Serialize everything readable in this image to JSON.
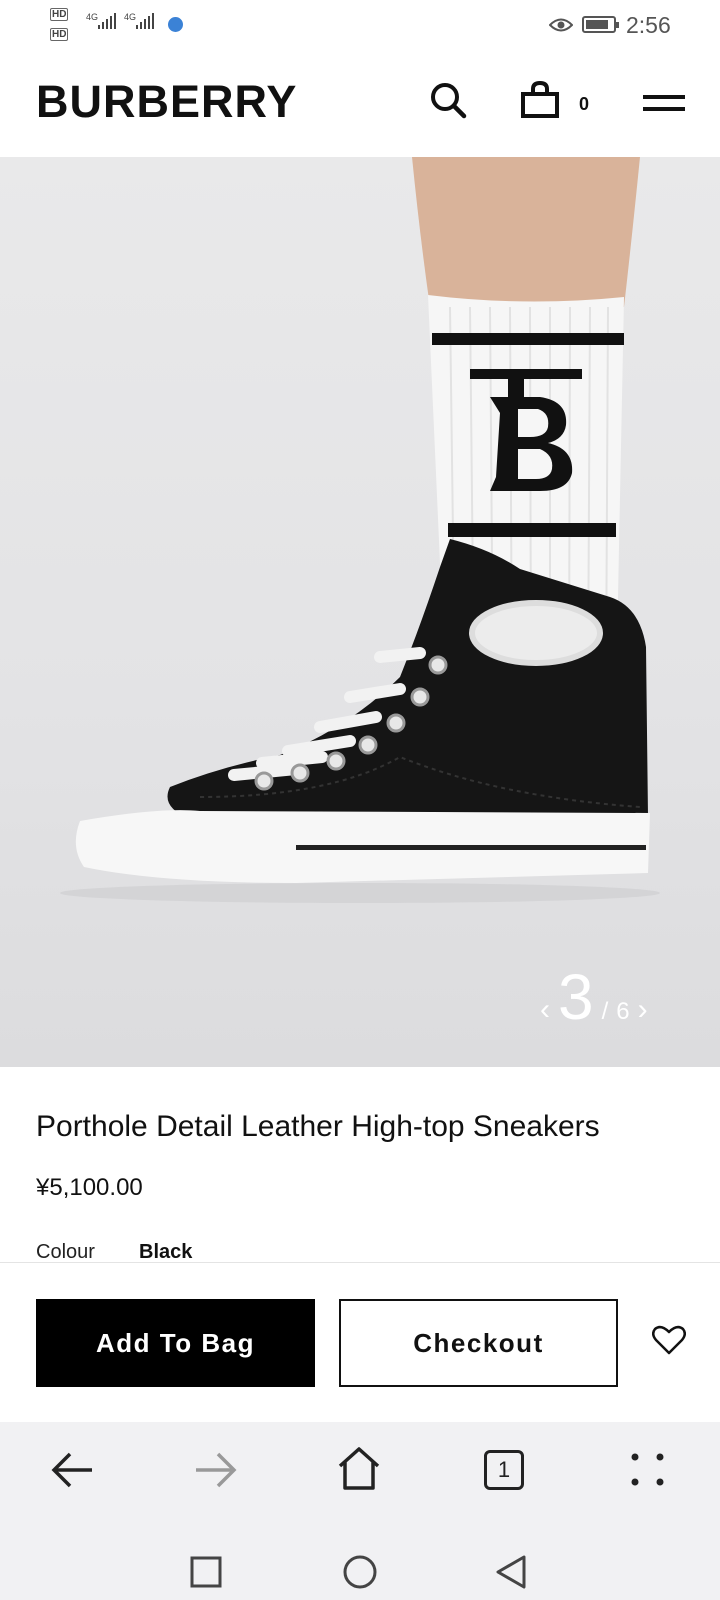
{
  "status_bar": {
    "hd1": "HD",
    "hd2": "HD",
    "sim1": "4G",
    "sim2": "4G",
    "time": "2:56"
  },
  "header": {
    "brand": "BURBERRY",
    "bag_count": "0",
    "icons": [
      "search-icon",
      "shopping-bag-icon",
      "menu-icon"
    ]
  },
  "gallery": {
    "current_index": "3",
    "separator": "/",
    "total": "6"
  },
  "product": {
    "title": "Porthole Detail Leather High-top Sneakers",
    "price": "¥5,100.00",
    "colour_label": "Colour",
    "colour_value": "Black"
  },
  "actions": {
    "add_to_bag": "Add To Bag",
    "checkout": "Checkout"
  },
  "browser_nav": {
    "tab_count": "1"
  },
  "colors": {
    "accent": "#000000",
    "hero_bg": "#e6e6e8",
    "nav_bg": "#f1f1f3"
  }
}
